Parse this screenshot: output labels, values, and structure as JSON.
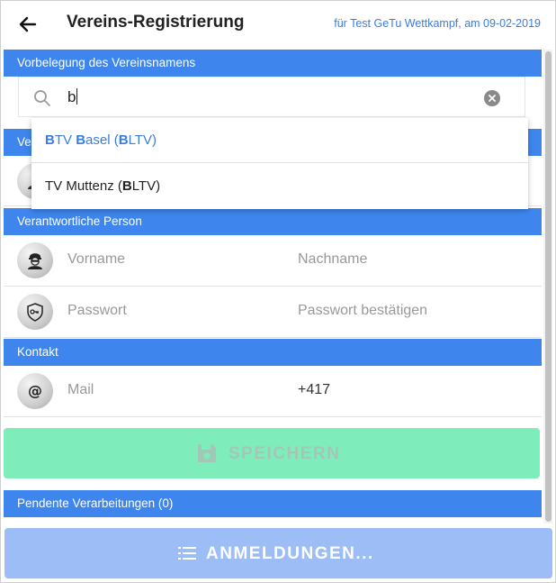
{
  "header": {
    "title": "Vereins-Registrierung",
    "event_info": "für Test GeTu Wettkampf, am 09-02-2019"
  },
  "sections": {
    "preset": "Vorbelegung des Vereinsnamens",
    "hidden_section_prefix": "Ve",
    "responsible": "Verantwortliche Person",
    "contact": "Kontakt",
    "pending": "Pendente Verarbeitungen (0)"
  },
  "search": {
    "value": "b",
    "suggestions": [
      {
        "parts": [
          {
            "text": "B",
            "bold": true
          },
          {
            "text": "TV ",
            "bold": false
          },
          {
            "text": "B",
            "bold": true
          },
          {
            "text": "asel (",
            "bold": false
          },
          {
            "text": "B",
            "bold": true
          },
          {
            "text": "LTV)",
            "bold": false
          }
        ]
      },
      {
        "parts": [
          {
            "text": "TV Muttenz (",
            "bold": false
          },
          {
            "text": "B",
            "bold": true
          },
          {
            "text": "LTV)",
            "bold": false
          }
        ]
      }
    ]
  },
  "fields": {
    "firstname_placeholder": "Vorname",
    "lastname_placeholder": "Nachname",
    "password_placeholder": "Passwort",
    "password_confirm_placeholder": "Passwort bestätigen",
    "mail_placeholder": "Mail",
    "phone_value": "+417"
  },
  "buttons": {
    "save_label": "SPEICHERN",
    "registrations_label": "ANMELDUNGEN..."
  },
  "colors": {
    "accent": "#3e86ee",
    "save_button": "#7eedbb",
    "registrations_button": "#9cbdf6",
    "link": "#3a7de0"
  },
  "icons": {
    "back": "arrow-left-icon",
    "search": "magnifier-icon",
    "clear": "circle-x-icon",
    "person": "masked-person-icon",
    "password": "shield-key-icon",
    "mail": "at-sign-icon",
    "save": "floppy-disk-icon",
    "list": "list-icon"
  }
}
